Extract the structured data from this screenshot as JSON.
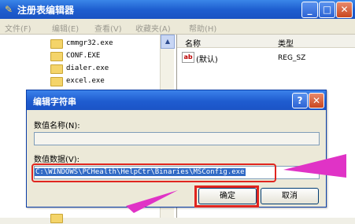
{
  "window": {
    "title": "注册表编辑器",
    "controls": {
      "minimize": "_",
      "maximize": "□",
      "close": "✕"
    }
  },
  "menu": {
    "items": [
      "文件(F)",
      "编辑(E)",
      "查看(V)",
      "收藏夹(A)",
      "帮助(H)"
    ]
  },
  "tree": {
    "items": [
      "cmmgr32.exe",
      "CONF.EXE",
      "dialer.exe",
      "excel.exe"
    ]
  },
  "value_list": {
    "headers": {
      "name": "名称",
      "type": "类型"
    },
    "rows": [
      {
        "name": "(默认)",
        "type": "REG_SZ"
      }
    ],
    "icon": "ab"
  },
  "dialog": {
    "title": "编辑字符串",
    "help_label": "?",
    "close_label": "✕",
    "value_name_label": "数值名称(N):",
    "value_name": "",
    "value_data_label": "数值数据(V):",
    "value_data": "C:\\WINDOWS\\PCHealth\\HelpCtr\\Binaries\\MSConfig.exe",
    "ok_label": "确定",
    "cancel_label": "取消"
  },
  "annotations": {
    "highlight_color": "#e0251f",
    "arrow_color": "#e033c6"
  }
}
